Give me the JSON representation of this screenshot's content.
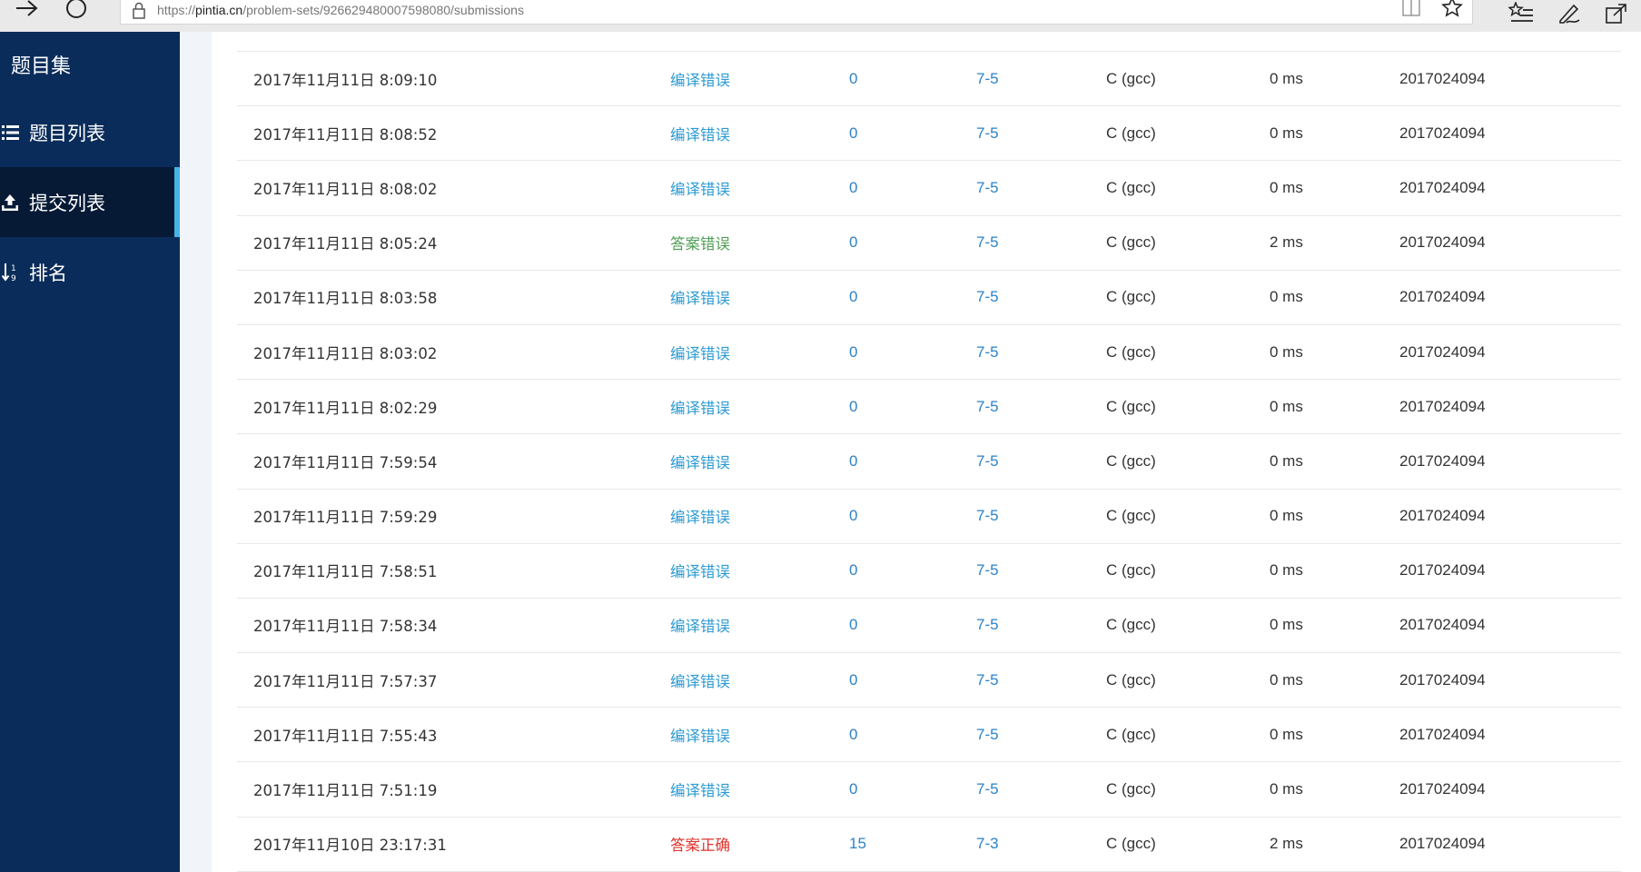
{
  "browser": {
    "url_prefix": "https://",
    "url_host": "pintia.cn",
    "url_path": "/problem-sets/926629480007598080/submissions"
  },
  "sidebar": {
    "title": "题目集",
    "items": [
      {
        "label": "题目列表",
        "icon": "list-icon",
        "active": false
      },
      {
        "label": "提交列表",
        "icon": "upload-icon",
        "active": true
      },
      {
        "label": "排名",
        "icon": "sort-icon",
        "active": false
      }
    ]
  },
  "colors": {
    "sidebar_bg": "#0a2c5a",
    "sidebar_active_bg": "#061a36",
    "active_indicator": "#45b4e8",
    "status_compile_error": "#2d9bd4",
    "status_wrong_answer": "#4f9e55",
    "status_accepted": "#e0322d",
    "link_blue": "#2d82c8"
  },
  "submissions": [
    {
      "time": "2017年11月11日 8:09:10",
      "status": "编译错误",
      "kind": "compile",
      "score": "0",
      "problem": "7-5",
      "compiler": "C (gcc)",
      "mem": "0 ms",
      "user": "2017024094"
    },
    {
      "time": "2017年11月11日 8:08:52",
      "status": "编译错误",
      "kind": "compile",
      "score": "0",
      "problem": "7-5",
      "compiler": "C (gcc)",
      "mem": "0 ms",
      "user": "2017024094"
    },
    {
      "time": "2017年11月11日 8:08:02",
      "status": "编译错误",
      "kind": "compile",
      "score": "0",
      "problem": "7-5",
      "compiler": "C (gcc)",
      "mem": "0 ms",
      "user": "2017024094"
    },
    {
      "time": "2017年11月11日 8:05:24",
      "status": "答案错误",
      "kind": "wrong",
      "score": "0",
      "problem": "7-5",
      "compiler": "C (gcc)",
      "mem": "2 ms",
      "user": "2017024094"
    },
    {
      "time": "2017年11月11日 8:03:58",
      "status": "编译错误",
      "kind": "compile",
      "score": "0",
      "problem": "7-5",
      "compiler": "C (gcc)",
      "mem": "0 ms",
      "user": "2017024094"
    },
    {
      "time": "2017年11月11日 8:03:02",
      "status": "编译错误",
      "kind": "compile",
      "score": "0",
      "problem": "7-5",
      "compiler": "C (gcc)",
      "mem": "0 ms",
      "user": "2017024094"
    },
    {
      "time": "2017年11月11日 8:02:29",
      "status": "编译错误",
      "kind": "compile",
      "score": "0",
      "problem": "7-5",
      "compiler": "C (gcc)",
      "mem": "0 ms",
      "user": "2017024094"
    },
    {
      "time": "2017年11月11日 7:59:54",
      "status": "编译错误",
      "kind": "compile",
      "score": "0",
      "problem": "7-5",
      "compiler": "C (gcc)",
      "mem": "0 ms",
      "user": "2017024094"
    },
    {
      "time": "2017年11月11日 7:59:29",
      "status": "编译错误",
      "kind": "compile",
      "score": "0",
      "problem": "7-5",
      "compiler": "C (gcc)",
      "mem": "0 ms",
      "user": "2017024094"
    },
    {
      "time": "2017年11月11日 7:58:51",
      "status": "编译错误",
      "kind": "compile",
      "score": "0",
      "problem": "7-5",
      "compiler": "C (gcc)",
      "mem": "0 ms",
      "user": "2017024094"
    },
    {
      "time": "2017年11月11日 7:58:34",
      "status": "编译错误",
      "kind": "compile",
      "score": "0",
      "problem": "7-5",
      "compiler": "C (gcc)",
      "mem": "0 ms",
      "user": "2017024094"
    },
    {
      "time": "2017年11月11日 7:57:37",
      "status": "编译错误",
      "kind": "compile",
      "score": "0",
      "problem": "7-5",
      "compiler": "C (gcc)",
      "mem": "0 ms",
      "user": "2017024094"
    },
    {
      "time": "2017年11月11日 7:55:43",
      "status": "编译错误",
      "kind": "compile",
      "score": "0",
      "problem": "7-5",
      "compiler": "C (gcc)",
      "mem": "0 ms",
      "user": "2017024094"
    },
    {
      "time": "2017年11月11日 7:51:19",
      "status": "编译错误",
      "kind": "compile",
      "score": "0",
      "problem": "7-5",
      "compiler": "C (gcc)",
      "mem": "0 ms",
      "user": "2017024094"
    },
    {
      "time": "2017年11月10日 23:17:31",
      "status": "答案正确",
      "kind": "accepted",
      "score": "15",
      "problem": "7-3",
      "compiler": "C (gcc)",
      "mem": "2 ms",
      "user": "2017024094"
    }
  ]
}
